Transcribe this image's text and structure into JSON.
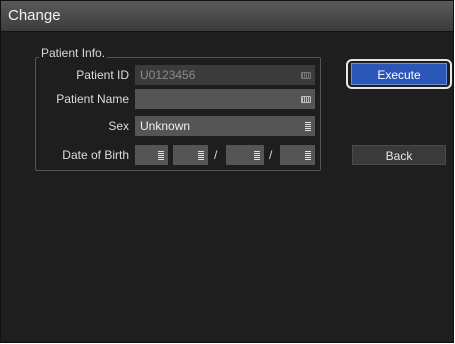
{
  "window": {
    "title": "Change"
  },
  "group": {
    "label": "Patient Info."
  },
  "fields": {
    "patient_id": {
      "label": "Patient ID",
      "value": "U0123456"
    },
    "patient_name": {
      "label": "Patient Name",
      "value": ""
    },
    "sex": {
      "label": "Sex",
      "value": "Unknown"
    },
    "dob": {
      "label": "Date of Birth",
      "separator": "/"
    }
  },
  "buttons": {
    "execute": "Execute",
    "back": "Back"
  },
  "colors": {
    "accent": "#2a56b8",
    "field_bg": "#555555",
    "window_bg": "#1e1e1e"
  },
  "icons": {
    "keyboard": "keyboard-icon",
    "list": "list-icon"
  }
}
